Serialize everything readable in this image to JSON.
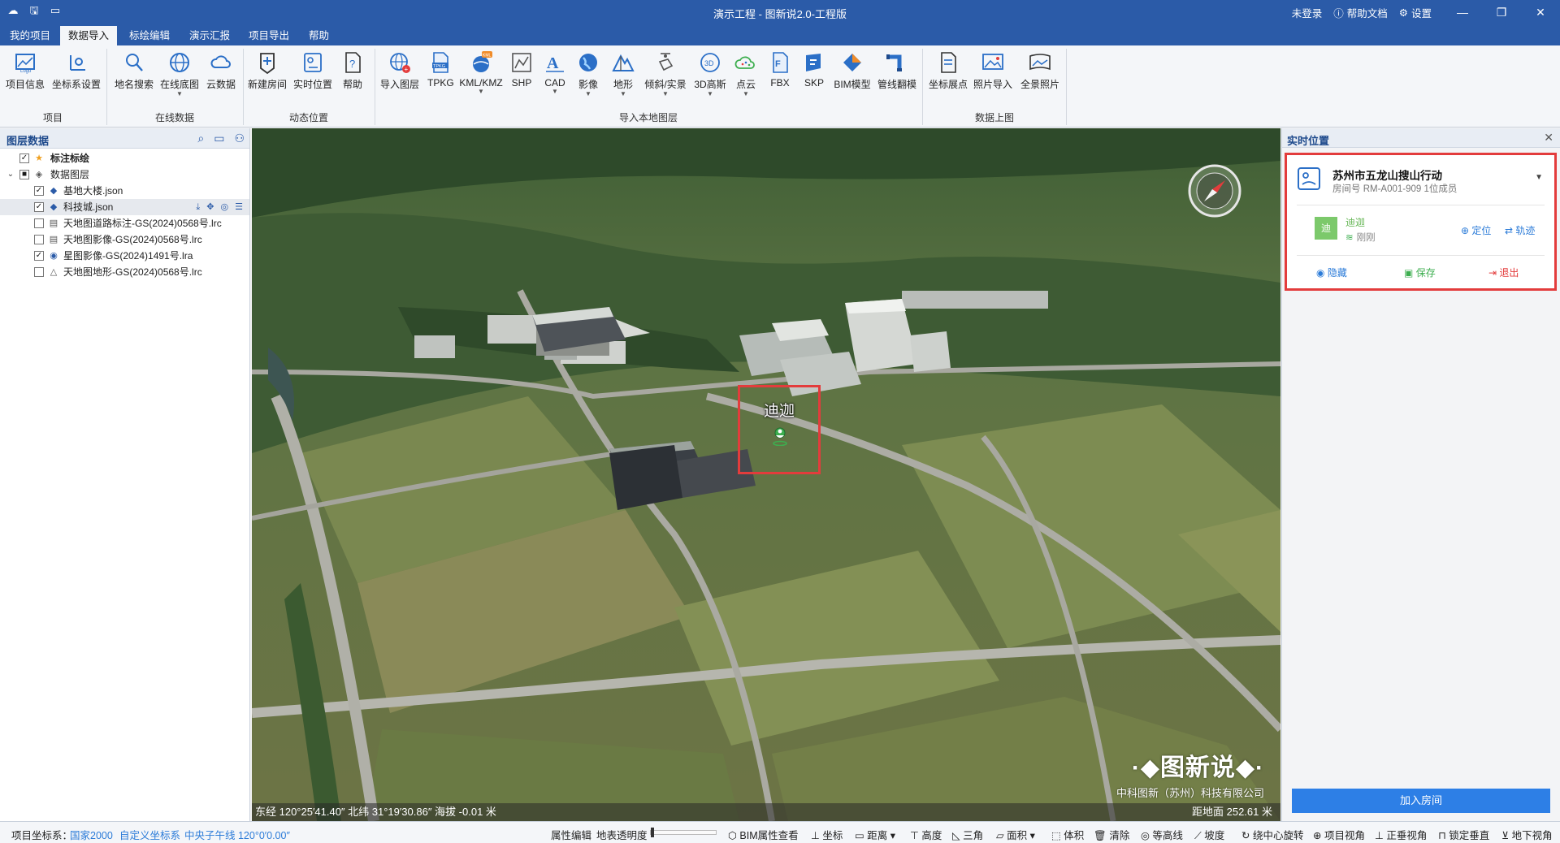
{
  "window": {
    "title": "演示工程 - 图新说2.0-工程版",
    "login": "未登录",
    "help_doc": "帮助文档",
    "settings": "设置"
  },
  "menu": {
    "tabs": [
      "我的项目",
      "数据导入",
      "标绘编辑",
      "演示汇报",
      "项目导出",
      "帮助"
    ],
    "active": "数据导入"
  },
  "ribbon": {
    "groups": {
      "project": "项目",
      "online": "在线数据",
      "dynamic": "动态位置",
      "local": "导入本地图层",
      "upload": "数据上图"
    },
    "buttons": {
      "project_info": "项目信息",
      "crs_settings": "坐标系设置",
      "place_search": "地名搜索",
      "online_basemap": "在线底图",
      "cloud_data": "云数据",
      "new_room": "新建房间",
      "realtime_position": "实时位置",
      "help": "帮助",
      "import_layer": "导入图层",
      "tpkg": "TPKG",
      "kml": "KML/KMZ",
      "shp": "SHP",
      "cad": "CAD",
      "imagery": "影像",
      "terrain": "地形",
      "oblique": "倾斜/实景",
      "gaussian": "3D高斯",
      "pointcloud": "点云",
      "fbx": "FBX",
      "skp": "SKP",
      "bim": "BIM模型",
      "pipeline": "管线翻模",
      "coord_points": "坐标展点",
      "photo_import": "照片导入",
      "panorama": "全景照片"
    }
  },
  "left_panel": {
    "title": "图层数据",
    "tree": {
      "plot_group": "标注标绘",
      "data_group": "数据图层",
      "items": [
        "基地大楼.json",
        "科技城.json",
        "天地图道路标注-GS(2024)0568号.lrc",
        "天地图影像-GS(2024)0568号.lrc",
        "星图影像-GS(2024)1491号.lra",
        "天地图地形-GS(2024)0568号.lrc"
      ]
    }
  },
  "map": {
    "marker_label": "迪迦",
    "status_left": "东经 120°25′41.40″  北纬 31°19′30.86″  海拔 -0.01 米",
    "status_right": "距地面 252.61 米",
    "watermark_title": "图新说",
    "watermark_company": "中科图新（苏州）科技有限公司"
  },
  "right_panel": {
    "title": "实时位置",
    "room_name": "苏州市五龙山搜山行动",
    "room_sub": "房间号 RM-A001-909  1位成员",
    "member": {
      "avatar": "迪",
      "name": "迪迦",
      "signal": "刚刚"
    },
    "locate": "定位",
    "track": "轨迹",
    "hide": "隐藏",
    "save": "保存",
    "exit": "退出",
    "join": "加入房间"
  },
  "statusbar": {
    "crs_label": "项目坐标系：",
    "crs_value": "国家2000",
    "custom_crs": "自定义坐标系",
    "meridian": "中央子午线 120°0′0.00″",
    "tools": [
      "属性编辑",
      "地表透明度",
      "BIM属性查看",
      "坐标",
      "距离",
      "高度",
      "三角",
      "面积",
      "体积",
      "清除",
      "等高线",
      "坡度",
      "绕中心旋转",
      "项目视角",
      "正垂视角",
      "锁定垂直",
      "地下视角"
    ]
  }
}
